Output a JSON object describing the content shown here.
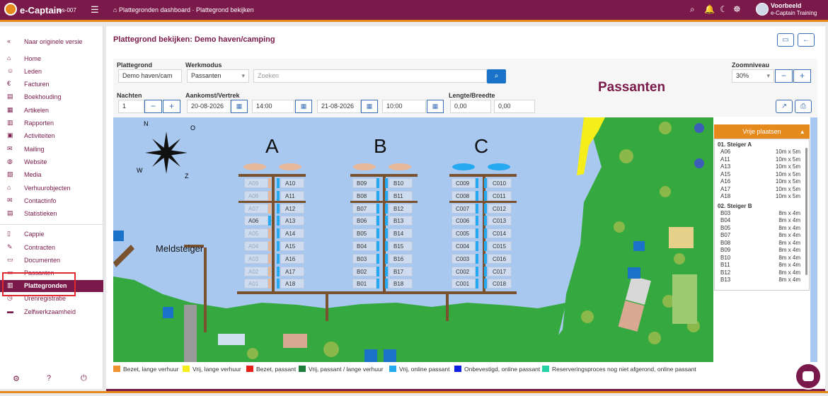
{
  "app": {
    "brand": "e-Captain",
    "workspace": "ws-007",
    "breadcrumb": "Plattegronden dashboard · Plattegrond bekijken",
    "user_line1": "Voorbeeld",
    "user_line2": "e-Captain Training"
  },
  "sidebar": {
    "back_label": "Naar originele versie",
    "items": [
      "Home",
      "Leden",
      "Facturen",
      "Boekhouding",
      "Artikelen",
      "Rapporten",
      "Activiteiten",
      "Mailing",
      "Website",
      "Media",
      "Verhuurobjecten",
      "Contactinfo",
      "Statistieken"
    ],
    "items2": [
      "Cappie",
      "Contracten",
      "Documenten",
      "Passanten",
      "Plattegronden",
      "Urenregistratie",
      "Zelfwerkzaamheid"
    ],
    "active": "Plattegronden"
  },
  "page": {
    "title": "Plattegrond bekijken: Demo haven/camping",
    "mode_title": "Passanten"
  },
  "filters": {
    "plattegrond_label": "Plattegrond",
    "plattegrond_value": "Demo haven/cam",
    "werkmodus_label": "Werkmodus",
    "werkmodus_value": "Passanten",
    "search_placeholder": "Zoeken",
    "zoom_label": "Zoomniveau",
    "zoom_value": "30%",
    "nachten_label": "Nachten",
    "nachten_value": "1",
    "aankomst_label": "Aankomst/Vertrek",
    "aankomst_date": "20-08-2026",
    "aankomst_time": "14:00",
    "vertrek_date": "21-08-2026",
    "vertrek_time": "10:00",
    "lengte_label": "Lengte/Breedte",
    "lengte_value": "0,00",
    "breedte_value": "0,00"
  },
  "map": {
    "docks": [
      "A",
      "B",
      "C"
    ],
    "meldsteiger_label": "Meldsteiger",
    "compass": [
      "N",
      "O",
      "W",
      "Z"
    ],
    "dock_a_left": [
      "A09",
      "A08",
      "A07",
      "A06",
      "A05",
      "A04",
      "A03",
      "A02",
      "A01"
    ],
    "dock_a_right": [
      "A10",
      "A11",
      "A12",
      "A13",
      "A14",
      "A15",
      "A16",
      "A17",
      "A18"
    ],
    "dock_b_left": [
      "B09",
      "B08",
      "B07",
      "B06",
      "B05",
      "B04",
      "B03",
      "B02",
      "B01"
    ],
    "dock_b_right": [
      "B10",
      "B11",
      "B12",
      "B13",
      "B14",
      "B15",
      "B16",
      "B17",
      "B18"
    ],
    "dock_c_left": [
      "C009",
      "C008",
      "C007",
      "C006",
      "C005",
      "C004",
      "C003",
      "C002",
      "C001"
    ],
    "dock_c_right": [
      "C010",
      "C011",
      "C012",
      "C013",
      "C014",
      "C015",
      "C016",
      "C017",
      "C018"
    ]
  },
  "vrije_plaatsen": {
    "title": "Vrije plaatsen",
    "groups": [
      {
        "name": "01. Steiger A",
        "rows": [
          [
            "A06",
            "10m x 5m"
          ],
          [
            "A11",
            "10m x 5m"
          ],
          [
            "A13",
            "10m x 5m"
          ],
          [
            "A15",
            "10m x 5m"
          ],
          [
            "A16",
            "10m x 5m"
          ],
          [
            "A17",
            "10m x 5m"
          ],
          [
            "A18",
            "10m x 5m"
          ]
        ]
      },
      {
        "name": "02. Steiger B",
        "rows": [
          [
            "B03",
            "8m x 4m"
          ],
          [
            "B04",
            "8m x 4m"
          ],
          [
            "B05",
            "8m x 4m"
          ],
          [
            "B07",
            "8m x 4m"
          ],
          [
            "B08",
            "8m x 4m"
          ],
          [
            "B09",
            "8m x 4m"
          ],
          [
            "B10",
            "8m x 4m"
          ],
          [
            "B11",
            "8m x 4m"
          ],
          [
            "B12",
            "8m x 4m"
          ],
          [
            "B13",
            "8m x 4m"
          ]
        ]
      }
    ]
  },
  "legend": [
    {
      "label": "Bezet, lange verhuur",
      "color": "#f0922d"
    },
    {
      "label": "Vrij, lange verhuur",
      "color": "#f5ee1a"
    },
    {
      "label": "Bezet, passant",
      "color": "#e8201c"
    },
    {
      "label": "Vrij, passant / lange verhuur",
      "color": "#1e7d3a"
    },
    {
      "label": "Vrij, online passant",
      "color": "#25a9f0"
    },
    {
      "label": "Onbevestigd, online passant",
      "color": "#1020e0"
    },
    {
      "label": "Reserveringsproces nog niet afgerond, online passant",
      "color": "#26d1a6"
    }
  ],
  "colors": {
    "brand": "#7a1a4a",
    "accent": "#e78a1e",
    "water": "#a8c8ef",
    "land": "#35a93f"
  }
}
